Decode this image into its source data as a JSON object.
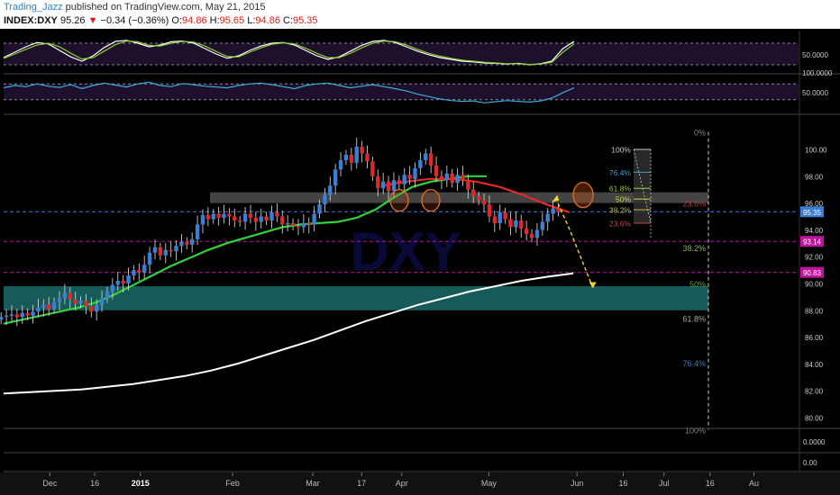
{
  "header": {
    "author": "Trading_Jazz",
    "published_text": " published on TradingView.com, May 21, 2015",
    "symbol": "INDEX:DXY",
    "last": "95.26",
    "arrow": "▼",
    "change": "−0.34 (−0.36%)",
    "o_label": "O:",
    "o_value": "94.86",
    "h_label": "H:",
    "h_value": "95.65",
    "l_label": "L:",
    "l_value": "94.86",
    "c_label": "C:",
    "c_value": "95.35"
  },
  "chart_data": [
    {
      "type": "line",
      "panel": "stochastic-oscillator",
      "yticks": [
        "50.0000"
      ],
      "band": [
        20,
        80
      ],
      "ylim": [
        0,
        100
      ],
      "series": [
        {
          "color": "#ffffff",
          "values": [
            40,
            55,
            70,
            82,
            78,
            60,
            42,
            30,
            45,
            68,
            85,
            88,
            80,
            70,
            75,
            84,
            86,
            80,
            65,
            50,
            38,
            45,
            60,
            72,
            80,
            82,
            75,
            60,
            45,
            35,
            42,
            58,
            74,
            85,
            88,
            82,
            70,
            58,
            48,
            40,
            35,
            30,
            28,
            25,
            24,
            22,
            24,
            20,
            23,
            30,
            65,
            85
          ]
        },
        {
          "color": "#8ad12c",
          "values": [
            38,
            50,
            63,
            75,
            80,
            70,
            52,
            36,
            40,
            58,
            76,
            86,
            84,
            74,
            72,
            80,
            85,
            83,
            72,
            57,
            43,
            42,
            55,
            67,
            77,
            81,
            78,
            66,
            52,
            40,
            40,
            52,
            67,
            80,
            86,
            84,
            75,
            63,
            52,
            44,
            38,
            33,
            30,
            27,
            25,
            23,
            23,
            21,
            22,
            27,
            55,
            78
          ]
        }
      ]
    },
    {
      "type": "line",
      "panel": "rsi",
      "yticks": [
        "100.0000",
        "50.0000"
      ],
      "band": [
        30,
        70
      ],
      "ylim": [
        0,
        100
      ],
      "series": [
        {
          "color": "#3ab0d6",
          "values": [
            60,
            66,
            63,
            70,
            64,
            61,
            68,
            58,
            66,
            72,
            67,
            62,
            70,
            74,
            66,
            63,
            71,
            68,
            64,
            62,
            60,
            66,
            70,
            72,
            68,
            63,
            58,
            66,
            70,
            72,
            66,
            60,
            64,
            68,
            63,
            58,
            52,
            44,
            38,
            32,
            28,
            26,
            27,
            22,
            25,
            28,
            26,
            24,
            27,
            34,
            48,
            60
          ]
        }
      ]
    },
    {
      "type": "candlestick",
      "panel": "price",
      "symbol": "INDEX:DXY",
      "ylim": [
        79,
        101.5
      ],
      "yticks": [
        "80.00",
        "82.00",
        "84.00",
        "86.00",
        "88.00",
        "90.00",
        "92.00",
        "94.00",
        "96.00",
        "98.00",
        "100.00"
      ],
      "price_labels": [
        {
          "text": "95.35",
          "value": 95.35,
          "color": "#3a7fd5"
        },
        {
          "text": "93.14",
          "value": 93.14,
          "color": "#c0119f"
        },
        {
          "text": "90.83",
          "value": 90.83,
          "color": "#c0119f"
        }
      ],
      "xticks": [
        "Dec",
        "16",
        "2015",
        "Feb",
        "Mar",
        "17",
        "Apr",
        "May",
        "Jun",
        "16",
        "Jul",
        "16",
        "Au"
      ],
      "xtick_values": [
        -30.0,
        -14.4,
        1.5,
        33.6,
        61.5,
        78.5,
        92.5,
        122.8,
        153.5,
        169.6,
        183.8,
        199.8,
        215.1
      ],
      "candles_x_range": [
        -47,
        147
      ],
      "closes": [
        87.5,
        87.6,
        87.7,
        87.5,
        87.8,
        87.6,
        87.9,
        88.2,
        88.4,
        88.1,
        88.6,
        88.9,
        89.3,
        88.8,
        88.5,
        88.7,
        88.3,
        87.9,
        88.4,
        88.9,
        89.4,
        89.9,
        90.2,
        90.0,
        90.6,
        91.0,
        90.8,
        91.4,
        92.3,
        92.7,
        92.1,
        92.5,
        92.4,
        92.8,
        93.1,
        92.9,
        93.3,
        94.4,
        95.1,
        94.8,
        95.2,
        94.9,
        95.2,
        95.0,
        94.7,
        94.6,
        95.2,
        94.9,
        94.6,
        95.0,
        94.7,
        95.3,
        95.0,
        94.4,
        94.5,
        94.3,
        94.2,
        94.5,
        94.4,
        95.2,
        95.9,
        96.6,
        97.3,
        98.5,
        99.2,
        99.6,
        99.0,
        100.2,
        99.7,
        99.1,
        98.0,
        97.1,
        97.6,
        96.9,
        97.7,
        97.4,
        98.1,
        97.8,
        98.6,
        99.2,
        99.7,
        98.8,
        98.0,
        97.7,
        98.2,
        97.5,
        98.1,
        97.7,
        97.0,
        96.5,
        96.2,
        95.9,
        95.0,
        94.5,
        95.3,
        94.8,
        94.2,
        94.7,
        94.1,
        93.7,
        93.4,
        94.0,
        94.6,
        95.2,
        95.6,
        95.35
      ],
      "sma_green": [
        87.0,
        87.3,
        87.6,
        87.9,
        88.2,
        88.6,
        89.2,
        89.9,
        90.6,
        91.3,
        91.9,
        92.5,
        93.0,
        93.4,
        93.8,
        94.2,
        94.4,
        94.5,
        94.6,
        94.9,
        95.5,
        96.4,
        97.2,
        97.6,
        97.8,
        98.0,
        98.0
      ],
      "sma_red": [
        97.3,
        97.6,
        97.8,
        97.8,
        97.6,
        97.2,
        96.6,
        95.9,
        95.3
      ],
      "sma_white": [
        81.8,
        81.9,
        82.0,
        82.1,
        82.3,
        82.5,
        82.8,
        83.1,
        83.5,
        84.0,
        84.6,
        85.2,
        85.8,
        86.5,
        87.2,
        87.8,
        88.4,
        88.9,
        89.4,
        89.8,
        90.2,
        90.5,
        90.75
      ],
      "fib_right": [
        {
          "label": "0%",
          "value": 101.3,
          "color": "#888888"
        },
        {
          "label": "23.6%",
          "value": 96.0,
          "color": "#b43c3c"
        },
        {
          "label": "38.2%",
          "value": 92.7,
          "color": "#8ab44a"
        },
        {
          "label": "50%",
          "value": 90.0,
          "color": "#66a03c"
        },
        {
          "label": "61.8%",
          "value": 87.4,
          "color": "#aaaaaa"
        },
        {
          "label": "76.4%",
          "value": 84.1,
          "color": "#3a78c0"
        },
        {
          "label": "100%",
          "value": 79.1,
          "color": "#888888"
        }
      ],
      "fib_small": [
        {
          "label": "100%",
          "value": 100.0,
          "color": "#cccccc"
        },
        {
          "label": "76.4%",
          "value": 98.3,
          "color": "#3aa0d0"
        },
        {
          "label": "61.8%",
          "value": 97.1,
          "color": "#9acd32"
        },
        {
          "label": "50%",
          "value": 96.3,
          "color": "#d2d24a"
        },
        {
          "label": "38.2%",
          "value": 95.5,
          "color": "#d2b432"
        },
        {
          "label": "23.6%",
          "value": 94.5,
          "color": "#c84646"
        }
      ],
      "resistance_zone": [
        96.0,
        96.8
      ],
      "support_zone": [
        88.0,
        89.8
      ],
      "watermark": "DXY",
      "forecast": [
        [
          146,
          96.4
        ],
        [
          151,
          94.0
        ],
        [
          159,
          89.7
        ]
      ]
    },
    {
      "type": "line",
      "panel": "bottom-indicator-1",
      "yticks": [
        "0.0000"
      ]
    },
    {
      "type": "line",
      "panel": "bottom-indicator-2",
      "yticks": [
        "0.00"
      ]
    }
  ]
}
